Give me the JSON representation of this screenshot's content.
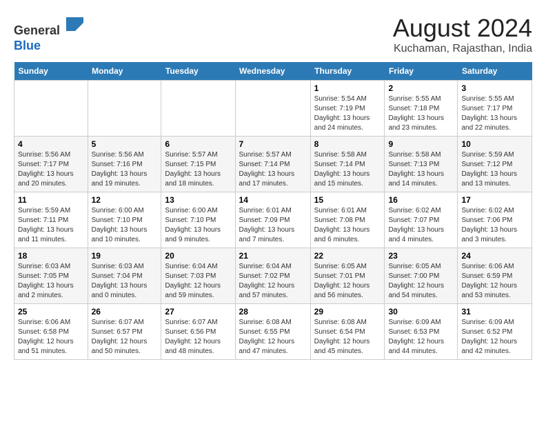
{
  "header": {
    "logo_line1": "General",
    "logo_line2": "Blue",
    "title": "August 2024",
    "subtitle": "Kuchaman, Rajasthan, India"
  },
  "weekdays": [
    "Sunday",
    "Monday",
    "Tuesday",
    "Wednesday",
    "Thursday",
    "Friday",
    "Saturday"
  ],
  "weeks": [
    [
      {
        "day": "",
        "info": ""
      },
      {
        "day": "",
        "info": ""
      },
      {
        "day": "",
        "info": ""
      },
      {
        "day": "",
        "info": ""
      },
      {
        "day": "1",
        "info": "Sunrise: 5:54 AM\nSunset: 7:19 PM\nDaylight: 13 hours\nand 24 minutes."
      },
      {
        "day": "2",
        "info": "Sunrise: 5:55 AM\nSunset: 7:18 PM\nDaylight: 13 hours\nand 23 minutes."
      },
      {
        "day": "3",
        "info": "Sunrise: 5:55 AM\nSunset: 7:17 PM\nDaylight: 13 hours\nand 22 minutes."
      }
    ],
    [
      {
        "day": "4",
        "info": "Sunrise: 5:56 AM\nSunset: 7:17 PM\nDaylight: 13 hours\nand 20 minutes."
      },
      {
        "day": "5",
        "info": "Sunrise: 5:56 AM\nSunset: 7:16 PM\nDaylight: 13 hours\nand 19 minutes."
      },
      {
        "day": "6",
        "info": "Sunrise: 5:57 AM\nSunset: 7:15 PM\nDaylight: 13 hours\nand 18 minutes."
      },
      {
        "day": "7",
        "info": "Sunrise: 5:57 AM\nSunset: 7:14 PM\nDaylight: 13 hours\nand 17 minutes."
      },
      {
        "day": "8",
        "info": "Sunrise: 5:58 AM\nSunset: 7:14 PM\nDaylight: 13 hours\nand 15 minutes."
      },
      {
        "day": "9",
        "info": "Sunrise: 5:58 AM\nSunset: 7:13 PM\nDaylight: 13 hours\nand 14 minutes."
      },
      {
        "day": "10",
        "info": "Sunrise: 5:59 AM\nSunset: 7:12 PM\nDaylight: 13 hours\nand 13 minutes."
      }
    ],
    [
      {
        "day": "11",
        "info": "Sunrise: 5:59 AM\nSunset: 7:11 PM\nDaylight: 13 hours\nand 11 minutes."
      },
      {
        "day": "12",
        "info": "Sunrise: 6:00 AM\nSunset: 7:10 PM\nDaylight: 13 hours\nand 10 minutes."
      },
      {
        "day": "13",
        "info": "Sunrise: 6:00 AM\nSunset: 7:10 PM\nDaylight: 13 hours\nand 9 minutes."
      },
      {
        "day": "14",
        "info": "Sunrise: 6:01 AM\nSunset: 7:09 PM\nDaylight: 13 hours\nand 7 minutes."
      },
      {
        "day": "15",
        "info": "Sunrise: 6:01 AM\nSunset: 7:08 PM\nDaylight: 13 hours\nand 6 minutes."
      },
      {
        "day": "16",
        "info": "Sunrise: 6:02 AM\nSunset: 7:07 PM\nDaylight: 13 hours\nand 4 minutes."
      },
      {
        "day": "17",
        "info": "Sunrise: 6:02 AM\nSunset: 7:06 PM\nDaylight: 13 hours\nand 3 minutes."
      }
    ],
    [
      {
        "day": "18",
        "info": "Sunrise: 6:03 AM\nSunset: 7:05 PM\nDaylight: 13 hours\nand 2 minutes."
      },
      {
        "day": "19",
        "info": "Sunrise: 6:03 AM\nSunset: 7:04 PM\nDaylight: 13 hours\nand 0 minutes."
      },
      {
        "day": "20",
        "info": "Sunrise: 6:04 AM\nSunset: 7:03 PM\nDaylight: 12 hours\nand 59 minutes."
      },
      {
        "day": "21",
        "info": "Sunrise: 6:04 AM\nSunset: 7:02 PM\nDaylight: 12 hours\nand 57 minutes."
      },
      {
        "day": "22",
        "info": "Sunrise: 6:05 AM\nSunset: 7:01 PM\nDaylight: 12 hours\nand 56 minutes."
      },
      {
        "day": "23",
        "info": "Sunrise: 6:05 AM\nSunset: 7:00 PM\nDaylight: 12 hours\nand 54 minutes."
      },
      {
        "day": "24",
        "info": "Sunrise: 6:06 AM\nSunset: 6:59 PM\nDaylight: 12 hours\nand 53 minutes."
      }
    ],
    [
      {
        "day": "25",
        "info": "Sunrise: 6:06 AM\nSunset: 6:58 PM\nDaylight: 12 hours\nand 51 minutes."
      },
      {
        "day": "26",
        "info": "Sunrise: 6:07 AM\nSunset: 6:57 PM\nDaylight: 12 hours\nand 50 minutes."
      },
      {
        "day": "27",
        "info": "Sunrise: 6:07 AM\nSunset: 6:56 PM\nDaylight: 12 hours\nand 48 minutes."
      },
      {
        "day": "28",
        "info": "Sunrise: 6:08 AM\nSunset: 6:55 PM\nDaylight: 12 hours\nand 47 minutes."
      },
      {
        "day": "29",
        "info": "Sunrise: 6:08 AM\nSunset: 6:54 PM\nDaylight: 12 hours\nand 45 minutes."
      },
      {
        "day": "30",
        "info": "Sunrise: 6:09 AM\nSunset: 6:53 PM\nDaylight: 12 hours\nand 44 minutes."
      },
      {
        "day": "31",
        "info": "Sunrise: 6:09 AM\nSunset: 6:52 PM\nDaylight: 12 hours\nand 42 minutes."
      }
    ]
  ]
}
